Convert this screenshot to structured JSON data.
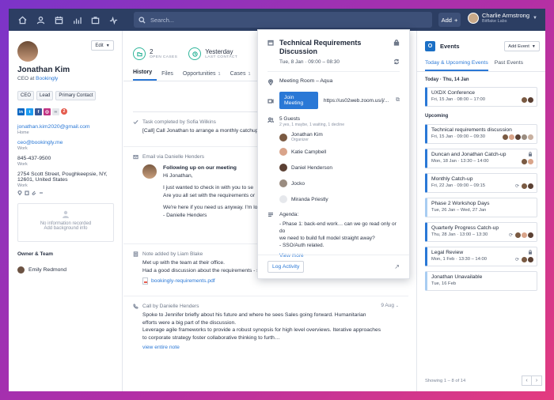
{
  "topbar": {
    "search_placeholder": "Search...",
    "add_label": "Add",
    "user_name": "Charlie Armstrong",
    "user_org": "Bitflake Labs"
  },
  "contact": {
    "edit_label": "Edit",
    "name": "Jonathan Kim",
    "title_prefix": "CEO at",
    "company": "Bookingly",
    "tags": [
      "CEO",
      "Lead",
      "Primary Contact"
    ],
    "social_badge": "2",
    "email1": "jonathan.kim2020@gmail.com",
    "email1_label": "Home",
    "email2": "ceo@bookingly.me",
    "email2_label": "Work",
    "phone": "845-437-9500",
    "phone_label": "Work",
    "address_line1": "2754 Scott Street, Poughkeepsie, NY,",
    "address_line2": "12601, United States",
    "address_label": "Work",
    "background_text1": "No information recorded",
    "background_text2": "Add background info",
    "owner_header": "Owner & Team",
    "owner_name": "Emily Redmond"
  },
  "stats": [
    {
      "num": "2",
      "label": "OPEN CASES"
    },
    {
      "num": "Yesterday",
      "label": "LAST CONTACT"
    }
  ],
  "tabs": [
    {
      "label": "History",
      "count": ""
    },
    {
      "label": "Files",
      "count": ""
    },
    {
      "label": "Opportunities",
      "count": "1"
    },
    {
      "label": "Cases",
      "count": "1"
    }
  ],
  "feed": {
    "task_head": "Task completed by Sofia Wilkins",
    "task_body": "[Call] Call Jonathan to arrange a monthly catchup",
    "email_head": "Email via Danielle Henders",
    "email_subject": "Following up on our meeting",
    "email_lines": [
      "Hi Jonathan,",
      "",
      "I just wanted to check in with you to se",
      "Are you all set with the requirements or",
      "",
      "We're here if you need us anyway. I'm lo",
      "- Danielle Henders"
    ],
    "note_head": "Note added by Liam Blake",
    "note_lines": [
      "Met up with the team at their office.",
      "Had a good discussion about the requirements - see attached file for more details."
    ],
    "note_file": "bookingly-requirements.pdf",
    "call_head": "Call by Danielle Henders",
    "call_date": "9 Aug",
    "call_lines": [
      "Spoke to Jennifer briefly about his future and where he sees Sales going forward. Humanitarian",
      "efforts were a big part of the discussion.",
      "Leverage agile frameworks to provide a robust synopsis for high level overviews. Iterative approaches",
      "to corporate strategy foster collaborative thinking to furth…"
    ],
    "call_link": "view entire note"
  },
  "popover": {
    "title_line1": "Technical Requirements",
    "title_line2": "Discussion",
    "time": "Tue, 8 Jan · 09:00 – 08:30",
    "location": "Meeting Room – Aqua",
    "join_label": "Join Meeting",
    "meet_url": "https://us02web.zoom.us/j/...",
    "guests_count": "5 Guests",
    "guests_summary": "2 yes, 1 maybe, 1 waiting, 1 decline",
    "guests": [
      {
        "name": "Jonathan Kim",
        "sub": "Organizer"
      },
      {
        "name": "Katie Campbell",
        "sub": ""
      },
      {
        "name": "Daniel Henderson",
        "sub": ""
      },
      {
        "name": "Jocko",
        "sub": ""
      },
      {
        "name": "Miranda Priestly",
        "sub": ""
      }
    ],
    "agenda_label": "Agenda:",
    "agenda_lines": [
      "- Phase 1: back-end work… can we go read only or do",
      "we need to build full model straight away?",
      "- SSO/Auth related."
    ],
    "view_more": "View more",
    "log_label": "Log Activity"
  },
  "events": {
    "title": "Events",
    "add_label": "Add Event",
    "tabs": [
      "Today & Upcoming Events",
      "Past Events"
    ],
    "today_header": "Today · Thu, 14 Jan",
    "upcoming_header": "Upcoming",
    "today": [
      {
        "name": "UXDX Conference",
        "time": "Fri, 15 Jan · 08:00 – 17:00"
      }
    ],
    "upcoming": [
      {
        "name": "Technical requirements discussion",
        "time": "Fri, 15 Jan · 09:00 – 09:30"
      },
      {
        "name": "Duncan and Jonathan Catch-up",
        "time": "Mon, 18 Jan · 13:30 – 14:00"
      },
      {
        "name": "Monthly Catch-up",
        "time": "Fri, 22 Jan · 09:00 – 09:15"
      },
      {
        "name": "Phase 2 Workshop Days",
        "time": "Tue, 26 Jan – Wed, 27 Jan"
      },
      {
        "name": "Quarterly Progress Catch-up",
        "time": "Thu, 28 Jan · 13:00 – 13:30"
      },
      {
        "name": "Legal Review",
        "time": "Mon, 1 Feb · 13:30 – 14:00"
      },
      {
        "name": "Jonathan Unavailable",
        "time": "Tue, 16 Feb"
      }
    ],
    "footer": "Showing 1 – 8 of 14"
  }
}
